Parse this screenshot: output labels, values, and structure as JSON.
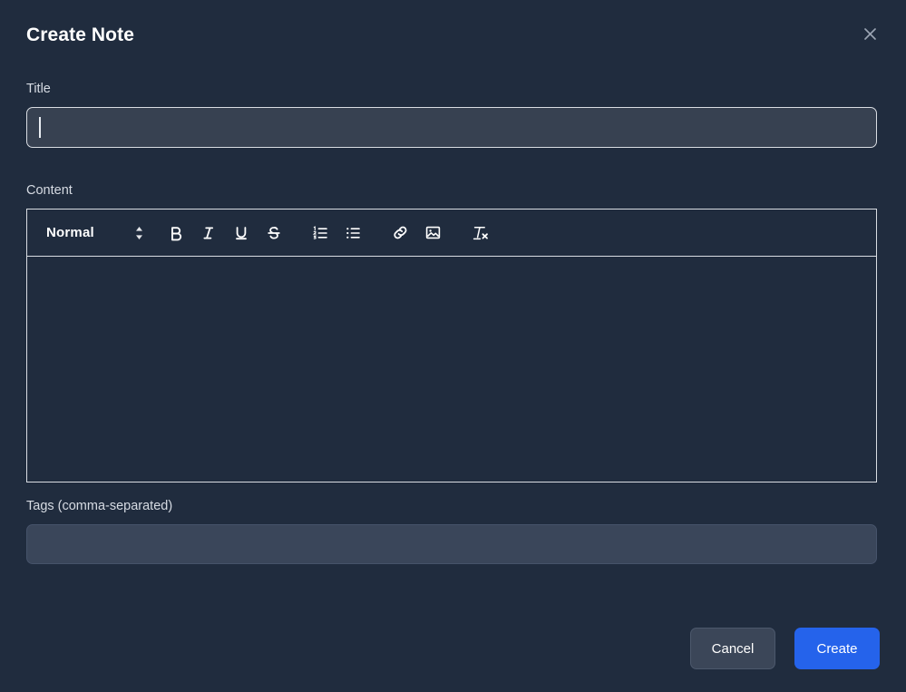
{
  "dialog": {
    "title": "Create Note",
    "close_icon": "close-icon",
    "accent_color": "#2563eb",
    "background_color": "#202c3e",
    "border_color": "#d9dde3"
  },
  "fields": {
    "title": {
      "label": "Title",
      "value": "",
      "placeholder": "",
      "focused": true
    },
    "content": {
      "label": "Content",
      "value": "",
      "placeholder": ""
    },
    "tags": {
      "label": "Tags (comma-separated)",
      "value": "",
      "placeholder": ""
    }
  },
  "toolbar": {
    "format_select": {
      "value": "Normal",
      "icon": "chevron-updown-icon"
    },
    "buttons": [
      {
        "name": "bold-button",
        "label": "B",
        "icon": "bold-icon"
      },
      {
        "name": "italic-button",
        "label": "I",
        "icon": "italic-icon"
      },
      {
        "name": "underline-button",
        "label": "U",
        "icon": "underline-icon"
      },
      {
        "name": "strikethrough-button",
        "label": "S",
        "icon": "strikethrough-icon"
      },
      {
        "name": "ordered-list-button",
        "label": "",
        "icon": "ordered-list-icon"
      },
      {
        "name": "bullet-list-button",
        "label": "",
        "icon": "bullet-list-icon"
      },
      {
        "name": "link-button",
        "label": "",
        "icon": "link-icon"
      },
      {
        "name": "image-button",
        "label": "",
        "icon": "image-icon"
      },
      {
        "name": "clear-format-button",
        "label": "",
        "icon": "clear-formatting-icon"
      }
    ]
  },
  "footer": {
    "cancel_label": "Cancel",
    "create_label": "Create"
  }
}
